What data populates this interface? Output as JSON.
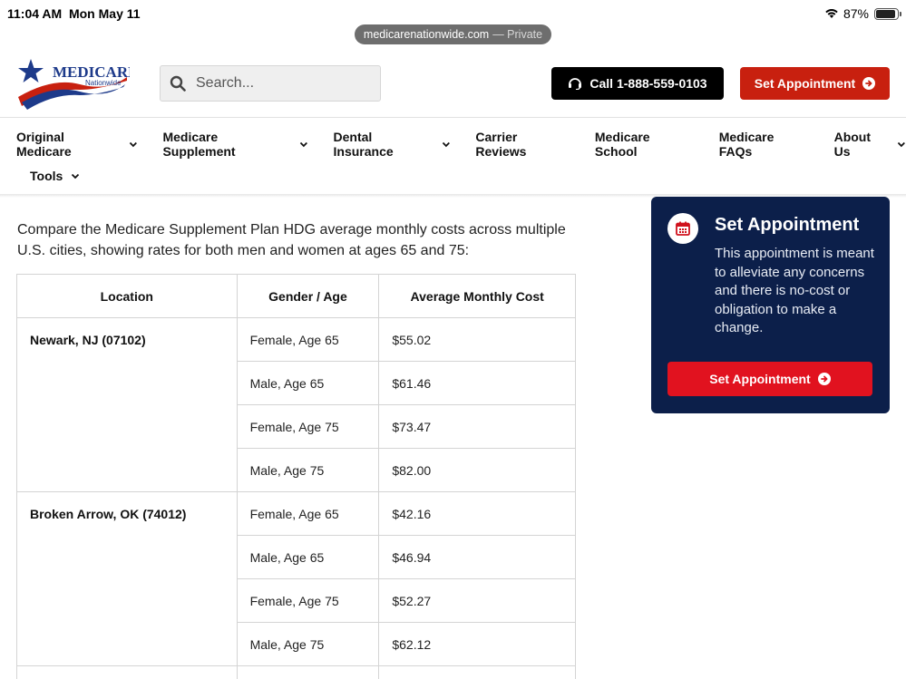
{
  "status": {
    "time": "11:04 AM",
    "date": "Mon May 11",
    "battery": "87%"
  },
  "browser": {
    "domain": "medicarenationwide.com",
    "mode": "— Private"
  },
  "logo": {
    "brand": "MEDICARE",
    "sub": "Nationwide"
  },
  "search": {
    "placeholder": "Search..."
  },
  "header": {
    "call_label": "Call 1-888-559-0103",
    "appointment_label": "Set Appointment"
  },
  "nav": {
    "items": [
      {
        "label": "Original Medicare",
        "dropdown": true
      },
      {
        "label": "Medicare Supplement",
        "dropdown": true
      },
      {
        "label": "Dental Insurance",
        "dropdown": true
      },
      {
        "label": "Carrier Reviews",
        "dropdown": false
      },
      {
        "label": "Medicare School",
        "dropdown": false
      },
      {
        "label": "Medicare FAQs",
        "dropdown": false
      },
      {
        "label": "About Us",
        "dropdown": true
      },
      {
        "label": "Tools",
        "dropdown": true
      }
    ]
  },
  "intro": "Compare the Medicare Supplement Plan HDG average monthly costs across multiple U.S. cities, showing rates for both men and women at ages 65 and 75:",
  "table": {
    "headers": [
      "Location",
      "Gender / Age",
      "Average Monthly Cost"
    ],
    "groups": [
      {
        "location": "Newark, NJ (07102)",
        "rows": [
          {
            "gender_age": "Female, Age 65",
            "cost": "$55.02"
          },
          {
            "gender_age": "Male, Age 65",
            "cost": "$61.46"
          },
          {
            "gender_age": "Female, Age 75",
            "cost": "$73.47"
          },
          {
            "gender_age": "Male, Age 75",
            "cost": "$82.00"
          }
        ]
      },
      {
        "location": "Broken Arrow, OK (74012)",
        "rows": [
          {
            "gender_age": "Female, Age 65",
            "cost": "$42.16"
          },
          {
            "gender_age": "Male, Age 65",
            "cost": "$46.94"
          },
          {
            "gender_age": "Female, Age 75",
            "cost": "$52.27"
          },
          {
            "gender_age": "Male, Age 75",
            "cost": "$62.12"
          }
        ]
      }
    ]
  },
  "sidebar": {
    "title": "Set Appointment",
    "text": "This appointment is meant to alleviate any concerns and there is no-cost or obligation to make a change.",
    "button_label": "Set Appointment"
  },
  "colors": {
    "brand_red": "#c8200f",
    "card_navy": "#0c1f4a",
    "card_button": "#e1121f"
  }
}
